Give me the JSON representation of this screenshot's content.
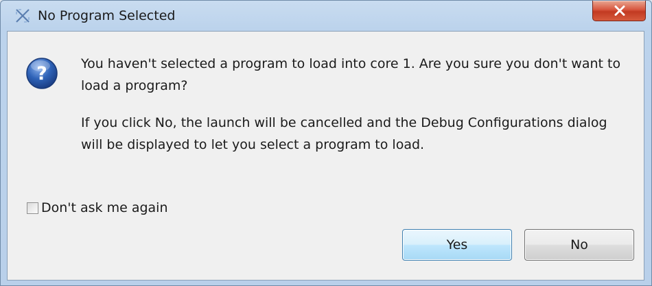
{
  "window": {
    "title": "No Program Selected",
    "icon": "program-launch-icon",
    "close_icon": "close-icon",
    "close_color": "#c8432b"
  },
  "dialog": {
    "icon": "question-icon",
    "icon_color": "#2f63b8",
    "message_1": "You haven't selected a program to load into core 1.  Are you sure you don't want to load a program?",
    "message_2": "If you click No, the launch will be cancelled and the Debug Configurations dialog will be displayed to let you select a program to load."
  },
  "checkbox": {
    "label": "Don't ask me again",
    "checked": false
  },
  "buttons": {
    "yes_label": "Yes",
    "no_label": "No"
  }
}
